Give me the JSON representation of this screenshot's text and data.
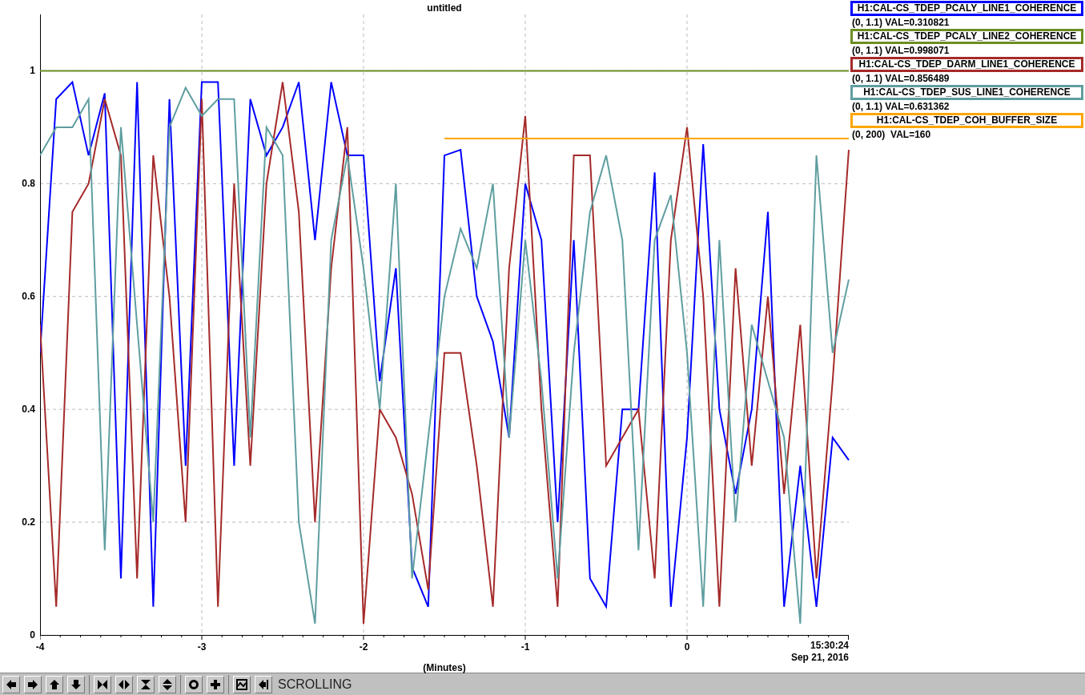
{
  "plot": {
    "end_time": "15:30:24",
    "end_date": "Sep 21, 2016",
    "chart_data": {
      "type": "line",
      "grid": true,
      "title": "untitled",
      "xlabel": "(Minutes)",
      "xlim": [
        -4,
        1
      ],
      "ylim": [
        0,
        1.1
      ],
      "xticks": [
        -4,
        -3,
        -2,
        -1,
        0
      ],
      "yticks": [
        1,
        0.8,
        0.6,
        0.4,
        0.2,
        0
      ],
      "x": [
        -4,
        -3.9,
        -3.8,
        -3.7,
        -3.6,
        -3.5,
        -3.4,
        -3.3,
        -3.2,
        -3.1,
        -3,
        -2.9,
        -2.8,
        -2.7,
        -2.6,
        -2.5,
        -2.4,
        -2.3,
        -2.2,
        -2.1,
        -2,
        -1.9,
        -1.8,
        -1.7,
        -1.6,
        -1.5,
        -1.4,
        -1.3,
        -1.2,
        -1.1,
        -1,
        -0.9,
        -0.8,
        -0.7,
        -0.6,
        -0.5,
        -0.4,
        -0.3,
        -0.2,
        -0.1,
        0,
        0.1,
        0.2,
        0.3,
        0.4,
        0.5,
        0.6,
        0.7,
        0.8,
        0.9,
        1
      ],
      "series": [
        {
          "name": "H1:CAL-CS_TDEP_PCALY_LINE1_COHERENCE",
          "color": "#0000ff",
          "values": [
            0.5,
            0.95,
            0.98,
            0.85,
            0.96,
            0.1,
            0.98,
            0.05,
            0.95,
            0.3,
            0.98,
            0.98,
            0.3,
            0.95,
            0.85,
            0.9,
            0.98,
            0.7,
            0.98,
            0.85,
            0.85,
            0.45,
            0.65,
            0.12,
            0.05,
            0.85,
            0.86,
            0.6,
            0.52,
            0.35,
            0.8,
            0.7,
            0.2,
            0.7,
            0.1,
            0.05,
            0.4,
            0.4,
            0.82,
            0.05,
            0.35,
            0.87,
            0.4,
            0.25,
            0.4,
            0.75,
            0.05,
            0.3,
            0.05,
            0.35,
            0.31
          ]
        },
        {
          "name": "H1:CAL-CS_TDEP_PCALY_LINE2_COHERENCE",
          "color": "#6b8e23",
          "values": [
            1,
            1,
            1,
            1,
            1,
            1,
            1,
            1,
            1,
            1,
            1,
            1,
            1,
            1,
            1,
            1,
            1,
            1,
            1,
            1,
            1,
            1,
            1,
            1,
            1,
            1,
            1,
            1,
            1,
            1,
            1,
            1,
            1,
            1,
            1,
            1,
            1,
            1,
            1,
            1,
            1,
            1,
            1,
            1,
            1,
            1,
            1,
            1,
            1,
            1,
            1
          ]
        },
        {
          "name": "H1:CAL-CS_TDEP_DARM_LINE1_COHERENCE",
          "color": "#a52a2a",
          "values": [
            0.55,
            0.05,
            0.75,
            0.8,
            0.95,
            0.85,
            0.1,
            0.85,
            0.6,
            0.2,
            0.95,
            0.05,
            0.8,
            0.3,
            0.8,
            0.98,
            0.75,
            0.2,
            0.65,
            0.9,
            0.02,
            0.4,
            0.35,
            0.25,
            0.08,
            0.5,
            0.5,
            0.3,
            0.05,
            0.65,
            0.92,
            0.4,
            0.05,
            0.85,
            0.85,
            0.3,
            0.35,
            0.4,
            0.1,
            0.7,
            0.9,
            0.6,
            0.05,
            0.65,
            0.3,
            0.6,
            0.25,
            0.55,
            0.1,
            0.45,
            0.86
          ]
        },
        {
          "name": "H1:CAL-CS_TDEP_SUS_LINE1_COHERENCE",
          "color": "#5f9ea0",
          "values": [
            0.85,
            0.9,
            0.9,
            0.95,
            0.15,
            0.9,
            0.55,
            0.2,
            0.9,
            0.97,
            0.92,
            0.95,
            0.95,
            0.35,
            0.9,
            0.85,
            0.2,
            0.02,
            0.7,
            0.85,
            0.65,
            0.4,
            0.8,
            0.1,
            0.35,
            0.6,
            0.72,
            0.65,
            0.8,
            0.35,
            0.7,
            0.45,
            0.1,
            0.5,
            0.75,
            0.85,
            0.7,
            0.15,
            0.7,
            0.78,
            0.5,
            0.05,
            0.7,
            0.2,
            0.55,
            0.45,
            0.35,
            0.02,
            0.85,
            0.5,
            0.63
          ]
        },
        {
          "name": "H1:CAL-CS_TDEP_COH_BUFFER_SIZE",
          "color": "#ffa500",
          "values": [
            null,
            null,
            null,
            null,
            null,
            null,
            null,
            null,
            null,
            null,
            null,
            null,
            null,
            null,
            null,
            null,
            null,
            null,
            null,
            null,
            null,
            null,
            null,
            null,
            null,
            0.88,
            0.88,
            0.88,
            0.88,
            0.88,
            0.88,
            0.88,
            0.88,
            0.88,
            0.88,
            0.88,
            0.88,
            0.88,
            0.88,
            0.88,
            0.88,
            0.88,
            0.88,
            0.88,
            0.88,
            0.88,
            0.88,
            0.88,
            0.88,
            0.88,
            0.88
          ]
        }
      ]
    }
  },
  "legend": [
    {
      "reading": "(0, 1.1) VAL=0.310821"
    },
    {
      "reading": "(0, 1.1) VAL=0.998071"
    },
    {
      "reading": "(0, 1.1) VAL=0.856489"
    },
    {
      "reading": "(0, 1.1) VAL=0.631362"
    },
    {
      "reading": "(0, 200)  VAL=160"
    }
  ],
  "toolbar": {
    "mode": "SCROLLING"
  }
}
